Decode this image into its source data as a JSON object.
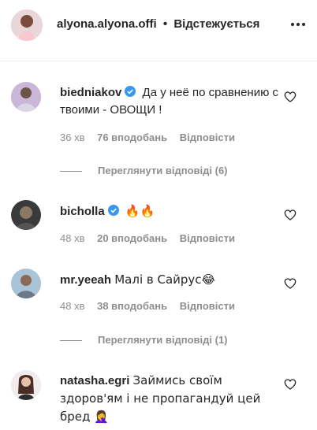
{
  "header": {
    "username": "alyona.alyona.offi",
    "separator": "•",
    "follow_status": "Відстежується",
    "more_icon": "more-dots-icon"
  },
  "comments": [
    {
      "username": "biedniakov",
      "verified": true,
      "text": "Да у неё по сравнению с твоими - ОВОЩИ !",
      "time": "36 хв",
      "likes": "76 вподобань",
      "reply": "Відповісти",
      "view_replies": "Переглянути відповіді (6)"
    },
    {
      "username": "bicholla",
      "verified": true,
      "text": "🔥🔥",
      "time": "48 хв",
      "likes": "20 вподобань",
      "reply": "Відповісти"
    },
    {
      "username": "mr.yeeah",
      "verified": false,
      "text": "Малі в Сайрус😂",
      "time": "48 хв",
      "likes": "38 вподобань",
      "reply": "Відповісти",
      "view_replies": "Переглянути відповіді (1)"
    },
    {
      "username": "natasha.egri",
      "verified": false,
      "text": "Займись своїм здоров'ям і не пропагандуй цей бред 🤦‍♀️"
    }
  ],
  "colors": {
    "text": "#262626",
    "secondary": "#8e8e8e",
    "verified": "#3897f0",
    "divider": "#efefef"
  }
}
